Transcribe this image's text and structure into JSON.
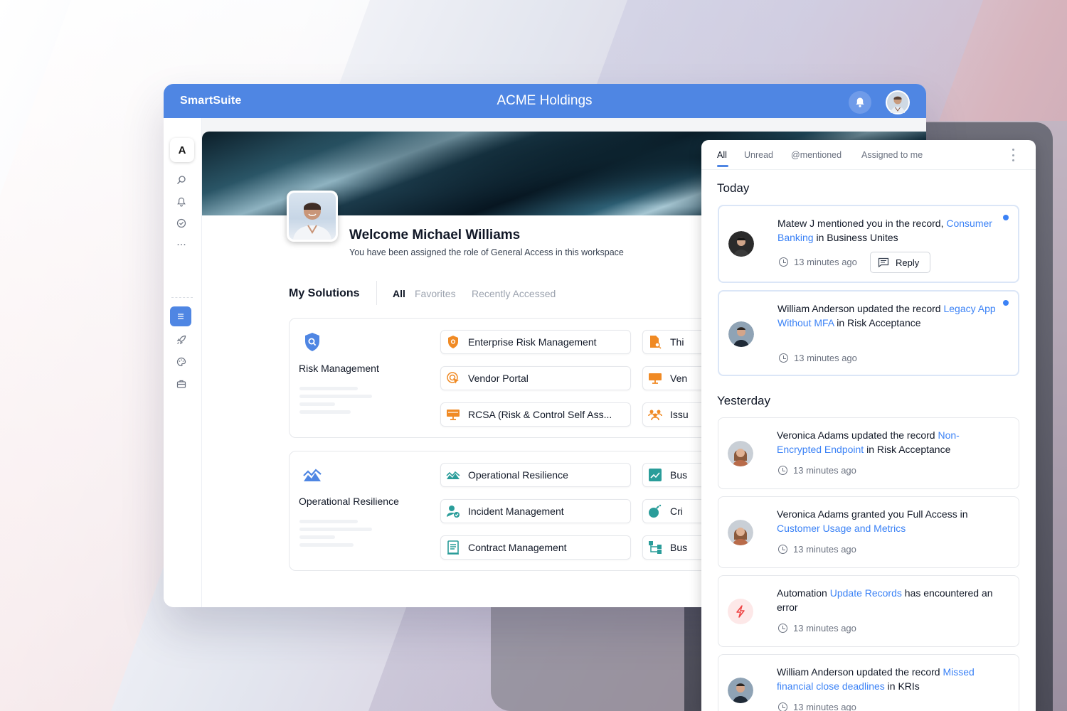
{
  "app": {
    "brand": "SmartSuite",
    "workspace_title": "ACME Holdings"
  },
  "sidebar": {
    "workspace_letter": "A",
    "icons": [
      "search-icon",
      "bell-icon",
      "check-circle-icon",
      "more-icon",
      "list-icon",
      "rocket-icon",
      "palette-icon",
      "briefcase-icon"
    ]
  },
  "profile": {
    "welcome": "Welcome Michael Williams",
    "role_text": "You have been assigned the role of General Access in this workspace"
  },
  "solutions": {
    "title": "My Solutions",
    "tabs": [
      "All",
      "Favorites",
      "Recently Accessed"
    ],
    "groups": [
      {
        "name": "Risk Management",
        "apps": [
          "Enterprise Risk Management",
          "Vendor Portal",
          "RCSA (Risk & Control Self Ass...",
          "Thi",
          "Ven",
          "Issu"
        ]
      },
      {
        "name": "Operational Resilience",
        "apps": [
          "Operational Resilience",
          "Incident Management",
          "Contract Management",
          "Bus",
          "Cri",
          "Bus"
        ]
      }
    ]
  },
  "notifications": {
    "tabs": [
      "All",
      "Unread",
      "@mentioned",
      "Assigned to me"
    ],
    "today_label": "Today",
    "yesterday_label": "Yesterday",
    "reply_label": "Reply",
    "items": [
      {
        "pre": "Matew J mentioned you in the record, ",
        "link": "Consumer Banking",
        "post": " in Business Unites",
        "time": "13 minutes ago"
      },
      {
        "pre": "William Anderson updated the record ",
        "link": "Legacy App Without MFA",
        "post": " in Risk Acceptance",
        "time": "13 minutes ago"
      },
      {
        "pre": "Veronica Adams updated the record  ",
        "link": "Non-Encrypted Endpoint",
        "post": " in Risk Acceptance",
        "time": "13 minutes ago"
      },
      {
        "pre": "Veronica Adams granted you Full Access in ",
        "link": "Customer Usage and Metrics",
        "post": "",
        "time": "13 minutes ago"
      },
      {
        "pre": "Automation  ",
        "link": "Update Records",
        "post": " has encountered an error",
        "time": "13 minutes ago"
      },
      {
        "pre": "William Anderson updated the record ",
        "link": "Missed financial close deadlines",
        "post": " in KRIs",
        "time": "13 minutes ago"
      }
    ]
  },
  "colors": {
    "accent": "#4f86e3",
    "link": "#3b82f6",
    "orange": "#f08a24",
    "teal": "#2a9d9a"
  }
}
